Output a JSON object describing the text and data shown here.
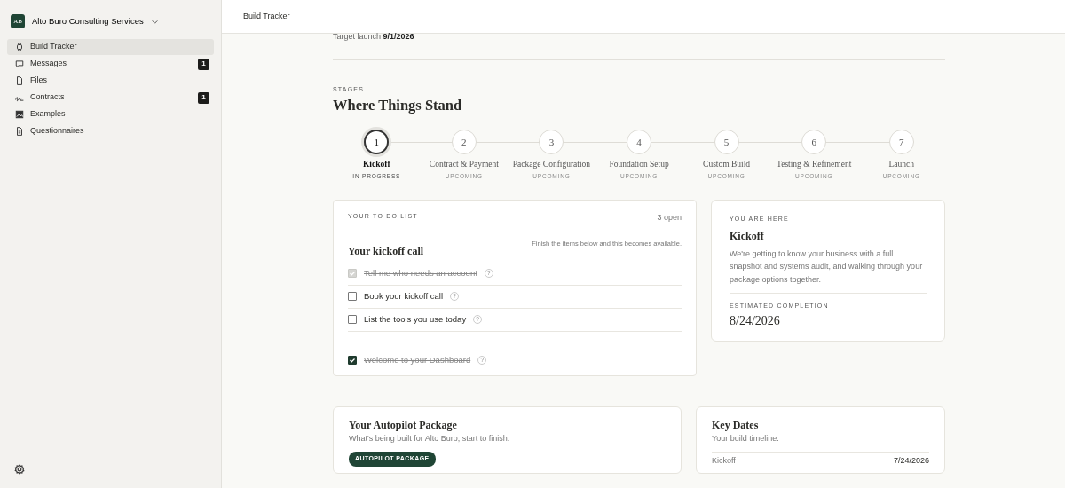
{
  "workspace": {
    "initials": "AB",
    "name": "Alto Buro Consulting Services"
  },
  "sidebar": {
    "items": [
      {
        "label": "Build Tracker",
        "selected": true
      },
      {
        "label": "Messages",
        "selected": false,
        "count": "1"
      },
      {
        "label": "Files",
        "selected": false
      },
      {
        "label": "Contracts",
        "selected": false,
        "count": "1"
      },
      {
        "label": "Examples",
        "selected": false
      },
      {
        "label": "Questionnaires",
        "selected": false
      }
    ]
  },
  "header": {
    "title": "Build Tracker"
  },
  "target_launch": {
    "label": "Target launch",
    "value": "9/1/2026"
  },
  "stages": {
    "eyebrow": "STAGES",
    "title": "Where Things Stand",
    "steps": [
      {
        "number": "1",
        "name": "Kickoff",
        "status": "IN PROGRESS",
        "selected": true
      },
      {
        "number": "2",
        "name": "Contract & Payment",
        "status": "UPCOMING",
        "selected": false
      },
      {
        "number": "3",
        "name": "Package Configuration",
        "status": "UPCOMING",
        "selected": false
      },
      {
        "number": "4",
        "name": "Foundation Setup",
        "status": "UPCOMING",
        "selected": false
      },
      {
        "number": "5",
        "name": "Custom Build",
        "status": "UPCOMING",
        "selected": false
      },
      {
        "number": "6",
        "name": "Testing & Refinement",
        "status": "UPCOMING",
        "selected": false
      },
      {
        "number": "7",
        "name": "Launch",
        "status": "UPCOMING",
        "selected": false
      }
    ]
  },
  "todo": {
    "eyebrow": "YOUR TO DO LIST",
    "count": "3 open",
    "title": "Your kickoff call",
    "note": "Finish the items below and this becomes available.",
    "items": [
      {
        "label": "Tell me who needs an account",
        "checked": true,
        "disabled": true,
        "help": "?"
      },
      {
        "label": "Book your kickoff call",
        "checked": false,
        "disabled": false,
        "help": "?"
      },
      {
        "label": "List the tools you use today",
        "checked": false,
        "disabled": false,
        "help": "?"
      }
    ],
    "extra_items": [
      {
        "label": "Welcome to your Dashboard",
        "checked": true,
        "disabled": false,
        "help": "?"
      }
    ]
  },
  "current": {
    "eyebrow": "YOU ARE HERE",
    "title": "Kickoff",
    "description": "We're getting to know your business with a full snapshot and systems audit, and walking through your package options together.",
    "completion_label": "ESTIMATED COMPLETION",
    "completion_date": "8/24/2026"
  },
  "package": {
    "title": "Your Autopilot Package",
    "subtitle": "What's being built for Alto Buro, start to finish.",
    "badge": "AUTOPILOT PACKAGE"
  },
  "key_dates": {
    "title": "Key Dates",
    "subtitle": "Your build timeline.",
    "rows": [
      {
        "label": "Kickoff",
        "date": "7/24/2026"
      }
    ]
  }
}
